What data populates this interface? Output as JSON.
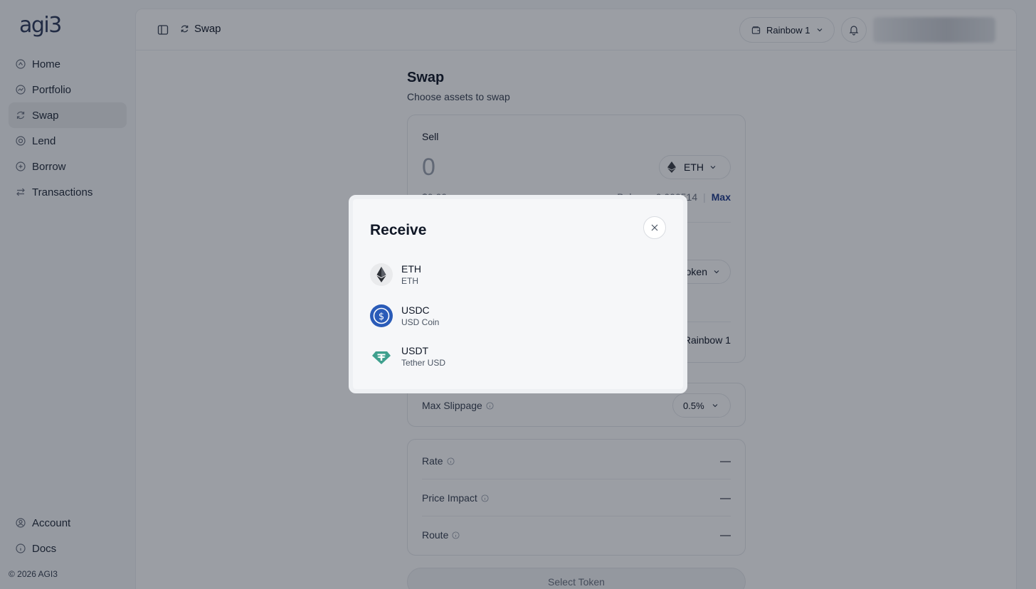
{
  "app": {
    "logo": "agi3",
    "copyright": "© 2026 AGI3"
  },
  "sidebar": {
    "items": [
      {
        "label": "Home",
        "icon": "home-icon"
      },
      {
        "label": "Portfolio",
        "icon": "chart-icon"
      },
      {
        "label": "Swap",
        "icon": "swap-icon",
        "active": true
      },
      {
        "label": "Lend",
        "icon": "lend-icon"
      },
      {
        "label": "Borrow",
        "icon": "borrow-icon"
      },
      {
        "label": "Transactions",
        "icon": "transactions-icon"
      }
    ],
    "bottom_items": [
      {
        "label": "Account",
        "icon": "account-icon"
      },
      {
        "label": "Docs",
        "icon": "info-icon"
      }
    ]
  },
  "header": {
    "breadcrumb": "Swap",
    "wallet_label": "Rainbow 1"
  },
  "swap": {
    "title": "Swap",
    "subtitle": "Choose assets to swap",
    "sell_label": "Sell",
    "sell_amount": "0",
    "sell_token": "ETH",
    "usd_value": "$0.00",
    "balance_label": "Balance",
    "balance_value": "0.000514",
    "max_label": "Max",
    "buy_token_label": "Token",
    "recipient_label": "Rainbow 1",
    "slippage_label": "Max Slippage",
    "slippage_value": "0.5%",
    "rate_label": "Rate",
    "rate_value": "—",
    "price_impact_label": "Price Impact",
    "price_impact_value": "—",
    "route_label": "Route",
    "route_value": "—",
    "select_button": "Select Token"
  },
  "modal": {
    "title": "Receive",
    "tokens": [
      {
        "symbol": "ETH",
        "name": "ETH",
        "icon": "eth-icon"
      },
      {
        "symbol": "USDC",
        "name": "USD Coin",
        "icon": "usdc-icon",
        "color": "#2775ca"
      },
      {
        "symbol": "USDT",
        "name": "Tether USD",
        "icon": "usdt-icon",
        "color": "#26a17b"
      }
    ]
  }
}
